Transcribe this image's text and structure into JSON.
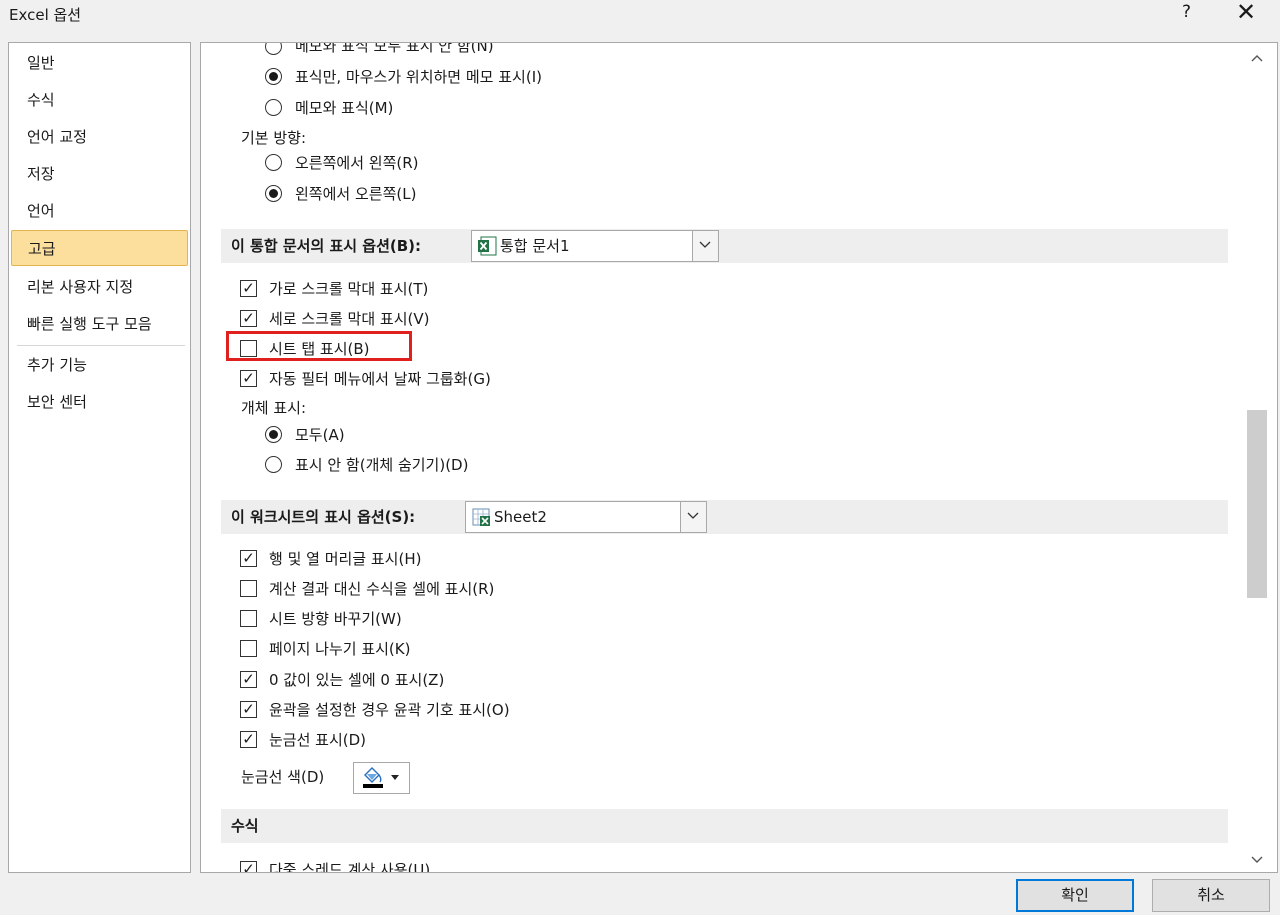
{
  "window": {
    "title": "Excel 옵션",
    "help": "?",
    "close": "✕"
  },
  "sidebar": {
    "items": [
      {
        "label": "일반"
      },
      {
        "label": "수식"
      },
      {
        "label": "언어 교정"
      },
      {
        "label": "저장"
      },
      {
        "label": "언어"
      },
      {
        "label": "고급"
      },
      {
        "label": "리본 사용자 지정"
      },
      {
        "label": "빠른 실행 도구 모음"
      },
      {
        "label": "추가 기능"
      },
      {
        "label": "보안 센터"
      }
    ],
    "active": "고급"
  },
  "comments": {
    "opt_none": "메모와 표식 모두 표시 안 함(N)",
    "opt_hover": "표식만, 마우스가 위치하면 메모 표시(I)",
    "opt_both": "메모와 표식(M)"
  },
  "direction": {
    "label": "기본 방향:",
    "rtl": "오른쪽에서 왼쪽(R)",
    "ltr": "왼쪽에서 오른쪽(L)"
  },
  "workbook_section": {
    "heading": "이 통합 문서의 표시 옵션(B):",
    "selected": "통합 문서1",
    "h_scroll": "가로 스크롤 막대 표시(T)",
    "v_scroll": "세로 스크롤 막대 표시(V)",
    "sheet_tabs": "시트 탭 표시(B)",
    "date_group": "자동 필터 메뉴에서 날짜 그룹화(G)",
    "objects_label": "개체 표시:",
    "objects_all": "모두(A)",
    "objects_none": "표시 안 함(개체 숨기기)(D)"
  },
  "worksheet_section": {
    "heading": "이 워크시트의 표시 옵션(S):",
    "selected": "Sheet2",
    "headers": "행 및 열 머리글 표시(H)",
    "formulas": "계산 결과 대신 수식을 셀에 표시(R)",
    "rtl_sheet": "시트 방향 바꾸기(W)",
    "page_breaks": "페이지 나누기 표시(K)",
    "zero": "0 값이 있는 셀에 0 표시(Z)",
    "outline": "윤곽을 설정한 경우 윤곽 기호 표시(O)",
    "gridlines": "눈금선 표시(D)",
    "grid_color": "눈금선 색(D)"
  },
  "formulas_section": {
    "heading": "수식",
    "multithread": "다중 스레드 계산 사용(U)"
  },
  "footer": {
    "ok": "확인",
    "cancel": "취소"
  },
  "colors": {
    "active_item": "#fcdf9c",
    "highlight_border": "#e0201c",
    "primary_border": "#0078d7"
  }
}
